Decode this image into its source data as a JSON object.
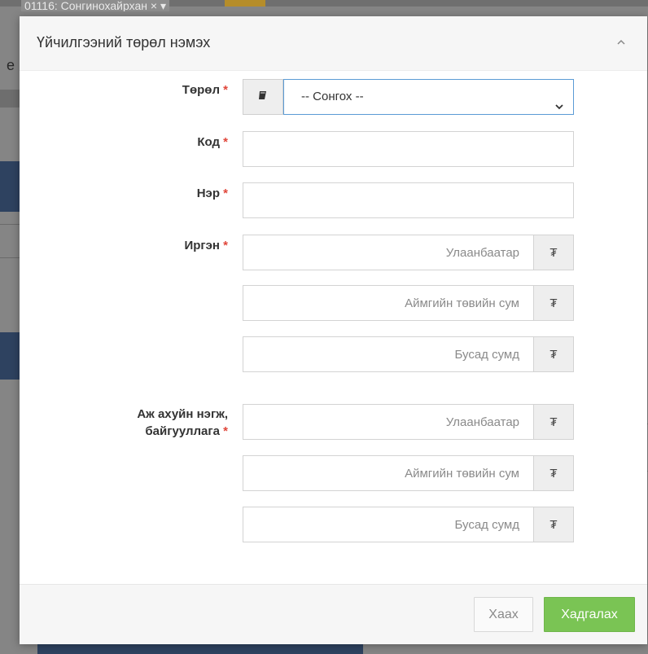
{
  "background": {
    "tag_chip": "01116: Сонгинохайрхан ×  ▾",
    "side_letter": "е"
  },
  "modal": {
    "title": "Үйчилгээний төрөл нэмэх",
    "collapse_icon": "chevron-up-icon"
  },
  "form": {
    "type": {
      "label": "Төрөл",
      "required_mark": "*",
      "addon_icon": "book-icon",
      "selected": "-- Сонгох --"
    },
    "code": {
      "label": "Код",
      "required_mark": "*",
      "value": ""
    },
    "name": {
      "label": "Нэр",
      "required_mark": "*",
      "value": ""
    },
    "citizen": {
      "label": "Иргэн",
      "required_mark": "*",
      "prices": [
        {
          "placeholder": "Улаанбаатар",
          "currency": "₮"
        },
        {
          "placeholder": "Аймгийн төвийн сум",
          "currency": "₮"
        },
        {
          "placeholder": "Бусад сумд",
          "currency": "₮"
        }
      ]
    },
    "organization": {
      "label_line1": "Аж ахуйн нэгж,",
      "label_line2": "байгууллага",
      "required_mark": "*",
      "prices": [
        {
          "placeholder": "Улаанбаатар",
          "currency": "₮"
        },
        {
          "placeholder": "Аймгийн төвийн сум",
          "currency": "₮"
        },
        {
          "placeholder": "Бусад сумд",
          "currency": "₮"
        }
      ]
    }
  },
  "footer": {
    "close_label": "Хаах",
    "save_label": "Хадгалах"
  },
  "colors": {
    "save_button": "#7ac454",
    "select_focus_border": "#5b9bd5",
    "required": "#e0463a"
  }
}
